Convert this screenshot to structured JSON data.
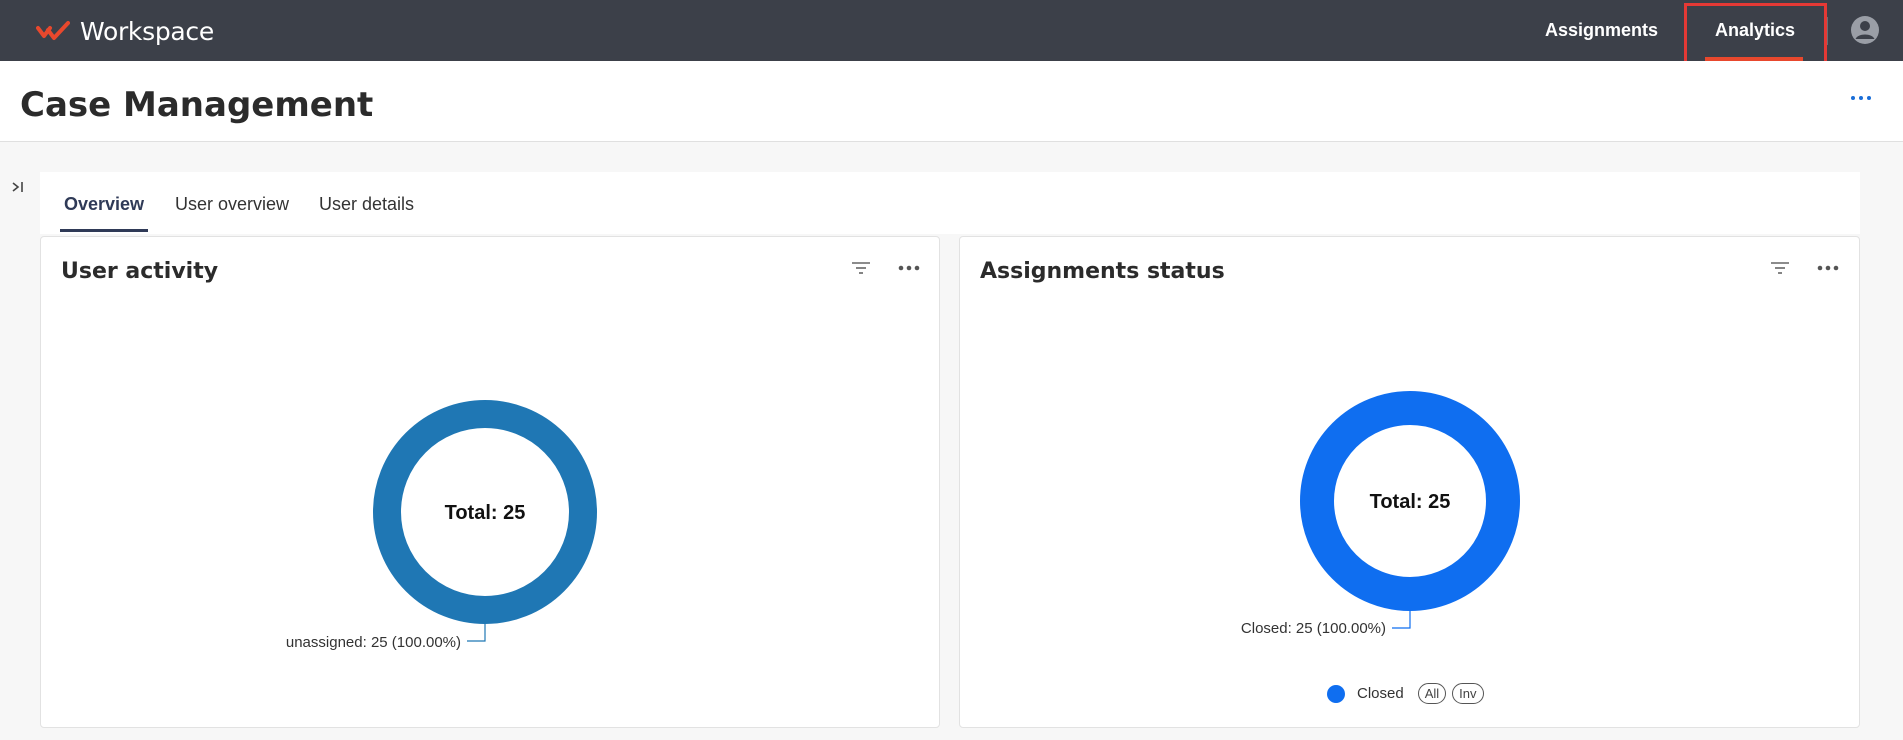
{
  "topbar": {
    "brand": "Workspace",
    "nav": [
      {
        "label": "Assignments"
      },
      {
        "label": "Analytics"
      }
    ]
  },
  "header": {
    "title": "Case Management"
  },
  "tabs": [
    {
      "label": "Overview"
    },
    {
      "label": "User overview"
    },
    {
      "label": "User details"
    }
  ],
  "cards": [
    {
      "title": "User activity"
    },
    {
      "title": "Assignments status"
    }
  ],
  "legend": {
    "item": "Closed",
    "all": "All",
    "inv": "Inv"
  },
  "colors": {
    "topbar": "#3c4049",
    "accent": "#e8482d",
    "user_activity": "#1f77b4",
    "assignments_status": "#0f6ef0"
  },
  "chart_data": [
    {
      "type": "pie",
      "title": "",
      "center_text": "Total: 25",
      "slices": [
        {
          "name": "unassigned",
          "value": 25,
          "label": "unassigned: 25 (100.00%)"
        }
      ]
    },
    {
      "type": "pie",
      "title": "",
      "center_text": "Total: 25",
      "slices": [
        {
          "name": "Closed",
          "value": 25,
          "label": "Closed: 25 (100.00%)"
        }
      ],
      "legend": [
        "Closed"
      ]
    }
  ]
}
